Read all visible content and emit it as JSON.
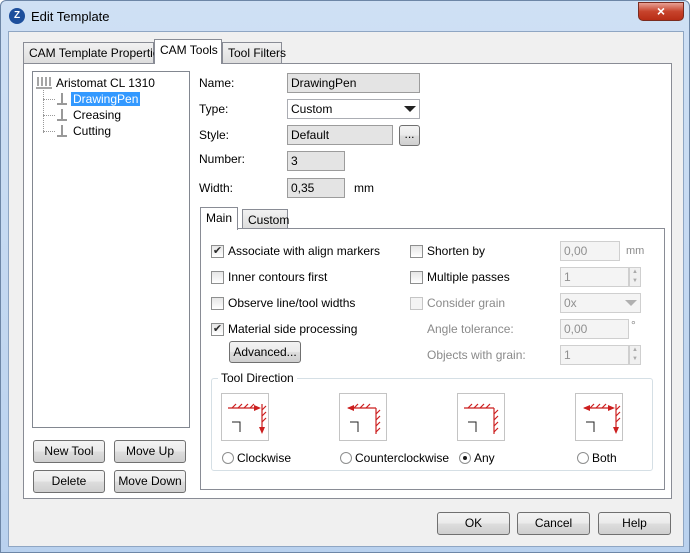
{
  "window": {
    "title": "Edit Template",
    "close_glyph": "×"
  },
  "tabs": [
    "CAM Template Properties",
    "CAM Tools",
    "Tool Filters"
  ],
  "tree": {
    "root": "Aristomat CL 1310",
    "children": [
      "DrawingPen",
      "Creasing",
      "Cutting"
    ],
    "selected": "DrawingPen"
  },
  "tree_buttons": {
    "new_tool": "New Tool",
    "move_up": "Move Up",
    "delete": "Delete",
    "move_down": "Move Down"
  },
  "props": {
    "name_label": "Name:",
    "name_value": "DrawingPen",
    "type_label": "Type:",
    "type_value": "Custom",
    "style_label": "Style:",
    "style_value": "Default",
    "style_browse": "...",
    "number_label": "Number:",
    "number_value": "3",
    "width_label": "Width:",
    "width_value": "0,35",
    "width_unit": "mm"
  },
  "subtabs": [
    "Main",
    "Custom"
  ],
  "options": {
    "associate": {
      "label": "Associate with align markers",
      "checked": true
    },
    "inner": {
      "label": "Inner contours first",
      "checked": false
    },
    "observe": {
      "label": "Observe line/tool widths",
      "checked": false
    },
    "material": {
      "label": "Material side processing",
      "checked": true
    },
    "advanced": "Advanced...",
    "shorten": {
      "label": "Shorten by",
      "value": "0,00",
      "unit": "mm",
      "checked": false
    },
    "multiple": {
      "label": "Multiple passes",
      "value": "1",
      "checked": false
    },
    "grain": {
      "label": "Consider grain",
      "value": "0x",
      "checked": false
    },
    "angle": {
      "label": "Angle tolerance:",
      "value": "0,00",
      "unit": "°"
    },
    "objects": {
      "label": "Objects with grain:",
      "value": "1"
    },
    "check_glyph": "✔"
  },
  "direction": {
    "group_label": "Tool Direction",
    "options": [
      "Clockwise",
      "Counterclockwise",
      "Any",
      "Both"
    ],
    "selected": "Any"
  },
  "footer": {
    "ok": "OK",
    "cancel": "Cancel",
    "help": "Help"
  },
  "colors": {
    "selection": "#3399ff",
    "arrow": "#cc1f1f"
  }
}
